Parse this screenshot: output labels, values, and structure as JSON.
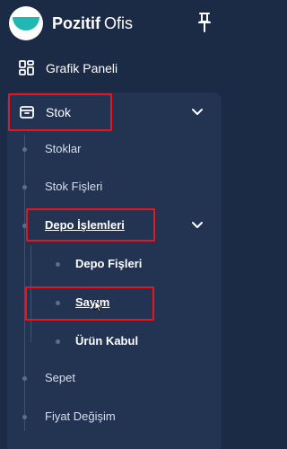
{
  "brand": {
    "strong": "Pozitif",
    "light": "Ofis",
    "logo": "pozitif-smile-logo",
    "accent": "#1fb8b2"
  },
  "header": {
    "pin_icon": "pin-icon"
  },
  "nav": {
    "dashboard": {
      "label": "Grafik Paneli",
      "icon": "dashboard-grid-icon"
    },
    "stock": {
      "label": "Stok",
      "icon": "box-icon",
      "expanded": true
    }
  },
  "stock_menu": {
    "items": [
      {
        "label": "Stoklar"
      },
      {
        "label": "Stok Fişleri"
      },
      {
        "label": "Depo İşlemleri",
        "expanded": true
      },
      {
        "label": "Sepet"
      },
      {
        "label": "Fiyat Değişim"
      }
    ],
    "warehouse_menu": {
      "items": [
        {
          "label": "Depo Fişleri"
        },
        {
          "label": "Sayım"
        },
        {
          "label": "Ürün Kabul"
        }
      ]
    }
  },
  "colors": {
    "sidebar_bg": "#1b2a45",
    "panel_bg": "#233453",
    "highlight": "#e8141e"
  }
}
